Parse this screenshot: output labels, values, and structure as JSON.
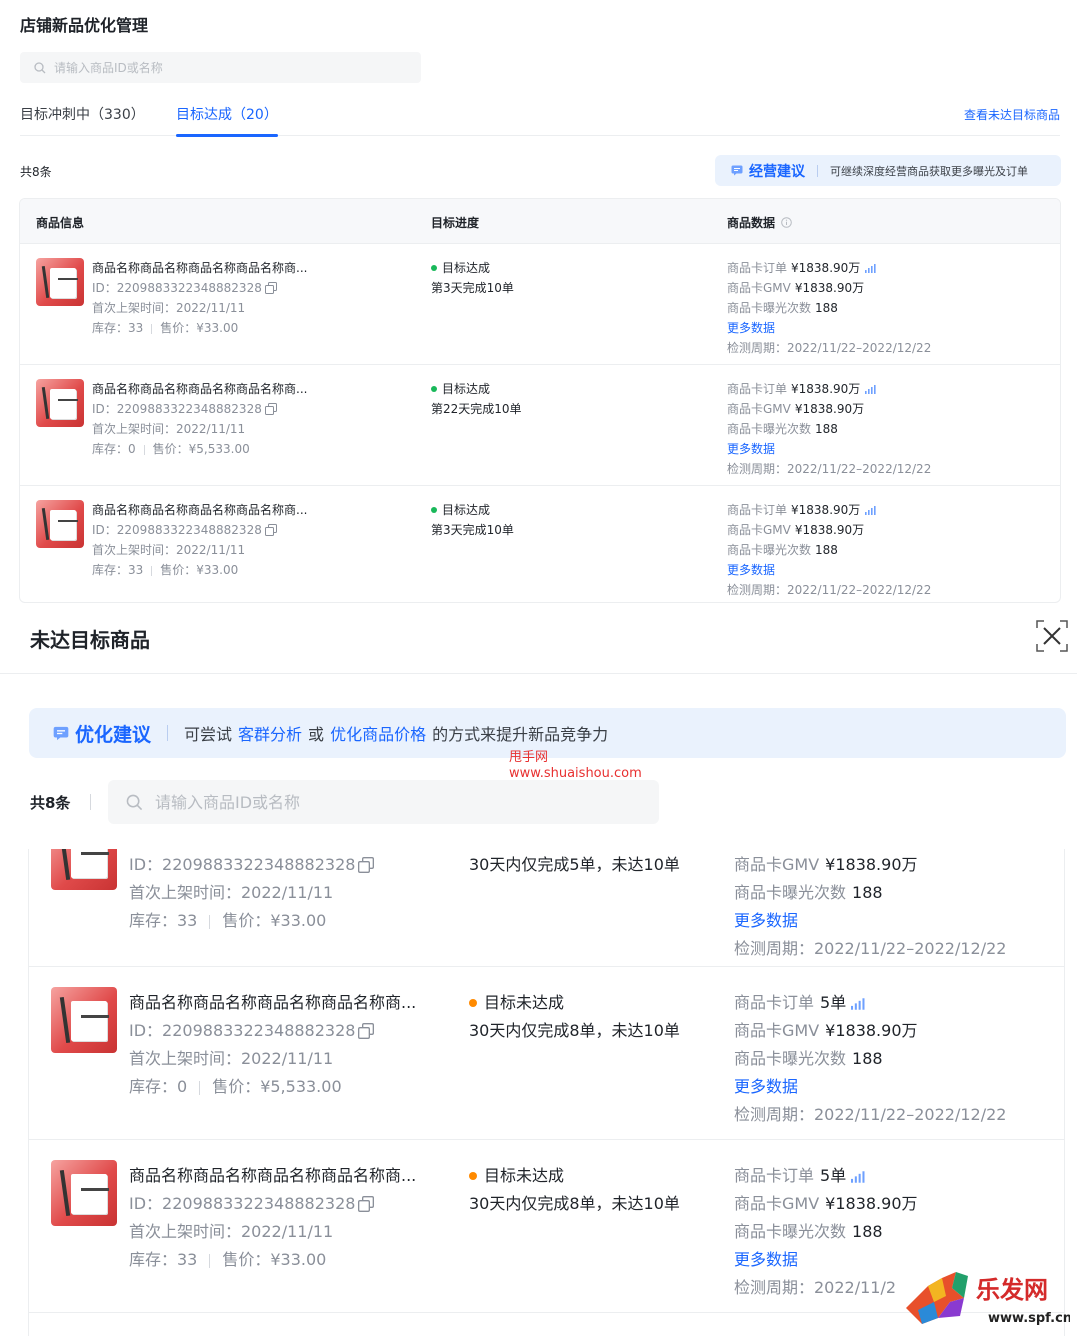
{
  "page": {
    "title": "店铺新品优化管理",
    "search_placeholder": "请输入商品ID或名称"
  },
  "tabs": [
    {
      "label": "目标冲刺中（330）"
    },
    {
      "label": "目标达成（20）"
    }
  ],
  "tab_link": "查看未达目标商品",
  "top_list": {
    "total": "共8条",
    "advice_title": "经营建议",
    "advice_desc": "可继续深度经营商品获取更多曝光及订单",
    "headers": {
      "info": "商品信息",
      "progress": "目标进度",
      "data": "商品数据"
    },
    "rows": [
      {
        "name": "商品名称商品名称商品名称商品名称商...",
        "id": "ID：22098833223488823​28",
        "first_time": "首次上架时间：2022/11/11",
        "stock": "库存：33",
        "price": "售价：¥33.00",
        "status": "目标达成",
        "status_sub": "第3天完成10单",
        "order_label": "商品卡订单",
        "order_val": "¥1838.90万",
        "gmv_label": "商品卡GMV",
        "gmv_val": "¥1838.90万",
        "exposure_label": "商品卡曝光次数",
        "exposure_val": "188",
        "more": "更多数据",
        "period": "检测周期：2022/11/22–2022/12/22"
      },
      {
        "name": "商品名称商品名称商品名称商品名称商...",
        "id": "ID：2209883322348882328",
        "first_time": "首次上架时间：2022/11/11",
        "stock": "库存：0",
        "price": "售价：¥5,533.00",
        "status": "目标达成",
        "status_sub": "第22天完成10单",
        "order_label": "商品卡订单",
        "order_val": "¥1838.90万",
        "gmv_label": "商品卡GMV",
        "gmv_val": "¥1838.90万",
        "exposure_label": "商品卡曝光次数",
        "exposure_val": "188",
        "more": "更多数据",
        "period": "检测周期：2022/11/22–2022/12/22"
      },
      {
        "name": "商品名称商品名称商品名称商品名称商...",
        "id": "ID：2209883322348882328",
        "first_time": "首次上架时间：2022/11/11",
        "stock": "库存：33",
        "price": "售价：¥33.00",
        "status": "目标达成",
        "status_sub": "第3天完成10单",
        "order_label": "商品卡订单",
        "order_val": "¥1838.90万",
        "gmv_label": "商品卡GMV",
        "gmv_val": "¥1838.90万",
        "exposure_label": "商品卡曝光次数",
        "exposure_val": "188",
        "more": "更多数据",
        "period": "检测周期：2022/11/22–2022/12/22"
      }
    ]
  },
  "overlay": {
    "title": "未达目标商品",
    "advice_title": "优化建议",
    "advice_pre": "可尝试",
    "advice_link1": "客群分析",
    "advice_mid": "或",
    "advice_link2": "优化商品价格",
    "advice_post": "的方式来提升新品竞争力",
    "watermark_line1": "甩手网",
    "watermark_line2": "www.shuaishou.com",
    "total": "共8条",
    "search_placeholder": "请输入商品ID或名称",
    "partial_row": {
      "id": "ID：2209883322348882328",
      "first_time": "首次上架时间：2022/11/11",
      "stock": "库存：33",
      "price": "售价：¥33.00",
      "status_sub": "30天内仅完成5单，未达10单",
      "gmv_label": "商品卡GMV",
      "gmv_val": "¥1838.90万",
      "exposure_label": "商品卡曝光次数",
      "exposure_val": "188",
      "more": "更多数据",
      "period": "检测周期：2022/11/22–2022/12/22"
    },
    "rows": [
      {
        "name": "商品名称商品名称商品名称商品名称商...",
        "id": "ID：2209883322348882328",
        "first_time": "首次上架时间：2022/11/11",
        "stock": "库存：0",
        "price": "售价：¥5,533.00",
        "status": "目标未达成",
        "status_sub": "30天内仅完成8单，未达10单",
        "order_label": "商品卡订单",
        "order_val": "5单",
        "gmv_label": "商品卡GMV",
        "gmv_val": "¥1838.90万",
        "exposure_label": "商品卡曝光次数",
        "exposure_val": "188",
        "more": "更多数据",
        "period": "检测周期：2022/11/22–2022/12/22"
      },
      {
        "name": "商品名称商品名称商品名称商品名称商...",
        "id": "ID：2209883322348882328",
        "first_time": "首次上架时间：2022/11/11",
        "stock": "库存：33",
        "price": "售价：¥33.00",
        "status": "目标未达成",
        "status_sub": "30天内仅完成8单，未达10单",
        "order_label": "商品卡订单",
        "order_val": "5单",
        "gmv_label": "商品卡GMV",
        "gmv_val": "¥1838.90万",
        "exposure_label": "商品卡曝光次数",
        "exposure_val": "188",
        "more": "更多数据",
        "period": "检测周期：2022/11/2"
      }
    ]
  },
  "logo_text": "乐发网",
  "logo_url": "www.spf.cn",
  "colors": {
    "accent": "#1a66ff",
    "success": "#19b85a",
    "warning": "#ff8a00",
    "brand_red": "#e83030"
  }
}
